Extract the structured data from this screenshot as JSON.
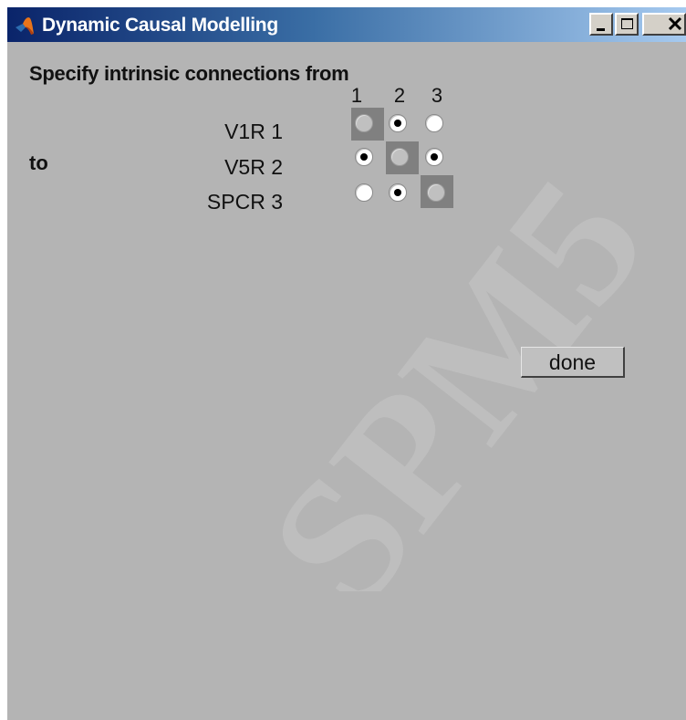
{
  "window": {
    "title": "Dynamic Causal Modelling",
    "controls": [
      "minimize-icon",
      "maximize-icon",
      "close-icon"
    ]
  },
  "dialog": {
    "heading": "Specify intrinsic connections from",
    "to_label": "to",
    "columns": [
      "1",
      "2",
      "3"
    ],
    "rows": [
      {
        "label": "V1R 1",
        "cells": [
          "disabled",
          "on",
          "off"
        ]
      },
      {
        "label": "V5R 2",
        "cells": [
          "on",
          "disabled",
          "on"
        ]
      },
      {
        "label": "SPCR 3",
        "cells": [
          "off",
          "on",
          "disabled"
        ]
      }
    ],
    "done_label": "done"
  },
  "watermark": {
    "text": "SPM5"
  },
  "colors": {
    "window_bg": "#b4b4b4",
    "titlebar_start": "#0a246a",
    "titlebar_end": "#a6caf0",
    "diagonal_cell": "#808080"
  }
}
